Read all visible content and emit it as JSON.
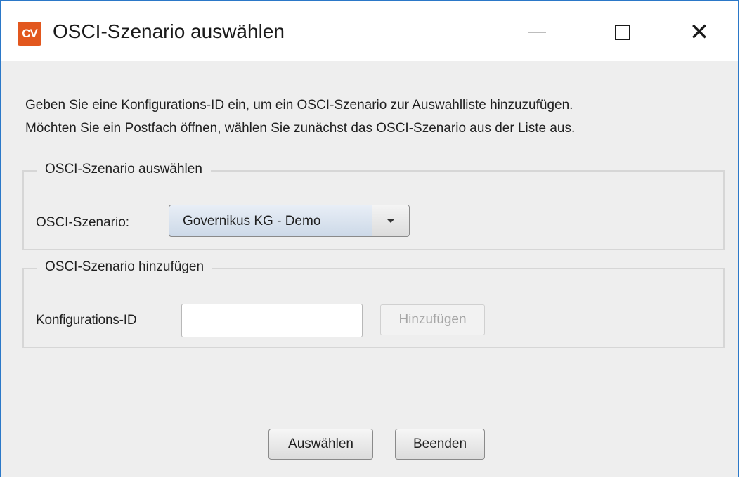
{
  "window": {
    "title": "OSCI-Szenario auswählen",
    "app_icon_text": "CV",
    "app_icon_color": "#e2571e"
  },
  "instructions": {
    "line1": "Geben Sie eine Konfigurations-ID ein, um ein OSCI-Szenario zur Auswahlliste hinzuzufügen.",
    "line2": "Möchten Sie ein Postfach öffnen, wählen Sie zunächst das OSCI-Szenario aus der Liste aus."
  },
  "select_group": {
    "legend": "OSCI-Szenario auswählen",
    "label": "OSCI-Szenario:",
    "selected_value": "Governikus KG - Demo"
  },
  "add_group": {
    "legend": "OSCI-Szenario hinzufügen",
    "label": "Konfigurations-ID",
    "input_value": "",
    "add_button_label": "Hinzufügen"
  },
  "footer": {
    "select_button_label": "Auswählen",
    "quit_button_label": "Beenden"
  }
}
